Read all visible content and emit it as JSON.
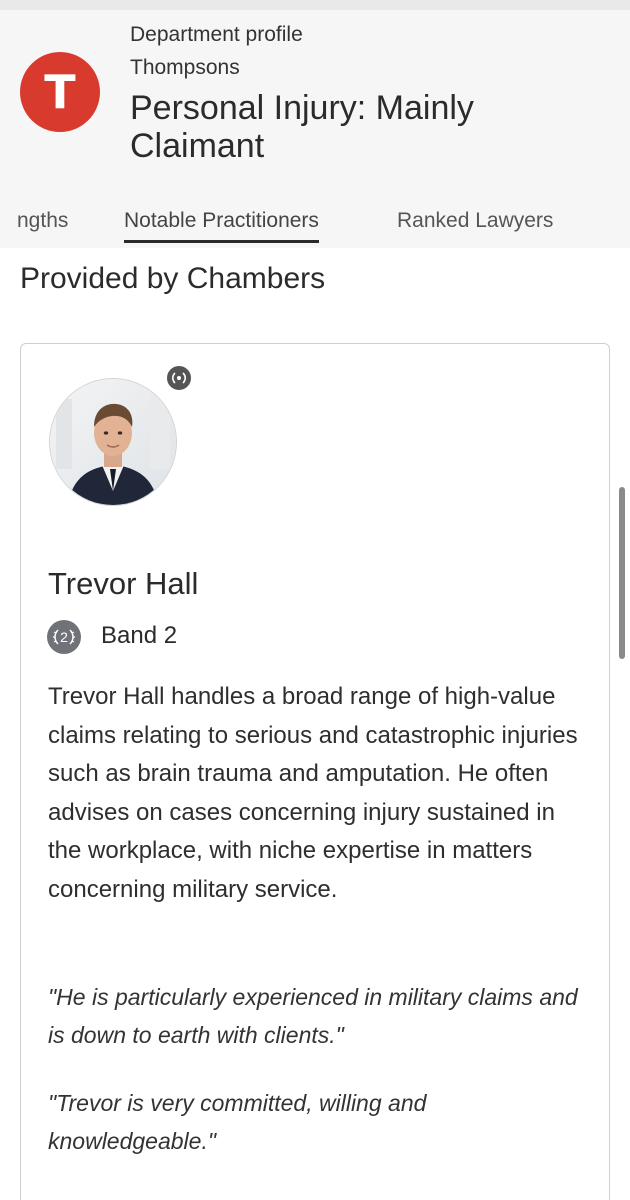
{
  "header": {
    "eyebrow": "Department profile",
    "firm": "Thompsons",
    "title_line1": "Personal Injury: Mainly",
    "title_line2": "Claimant",
    "logo_letter": "T",
    "brand_color": "#d83b2e"
  },
  "tabs": [
    {
      "label": "ngths",
      "active": false
    },
    {
      "label": "Notable Practitioners",
      "active": true
    },
    {
      "label": "Ranked Lawyers",
      "active": false
    }
  ],
  "section_title": "Provided by Chambers",
  "practitioner": {
    "name": "Trevor Hall",
    "band_number": "2",
    "band_label": "Band 2",
    "description": "Trevor Hall handles a broad range of high-value claims relating to serious and catastrophic injuries such as brain trauma and amputation. He often advises on cases concerning injury sustained in the workplace, with niche expertise in matters concerning military service.",
    "quotes": [
      "\"He is particularly experienced in military claims and is down to earth with clients.\"",
      "\"Trevor is very committed, willing and knowledgeable.\""
    ]
  },
  "icons": {
    "logo": "thompsons-logo-icon",
    "badge": "laurel-icon",
    "band": "band-laurel-icon"
  }
}
